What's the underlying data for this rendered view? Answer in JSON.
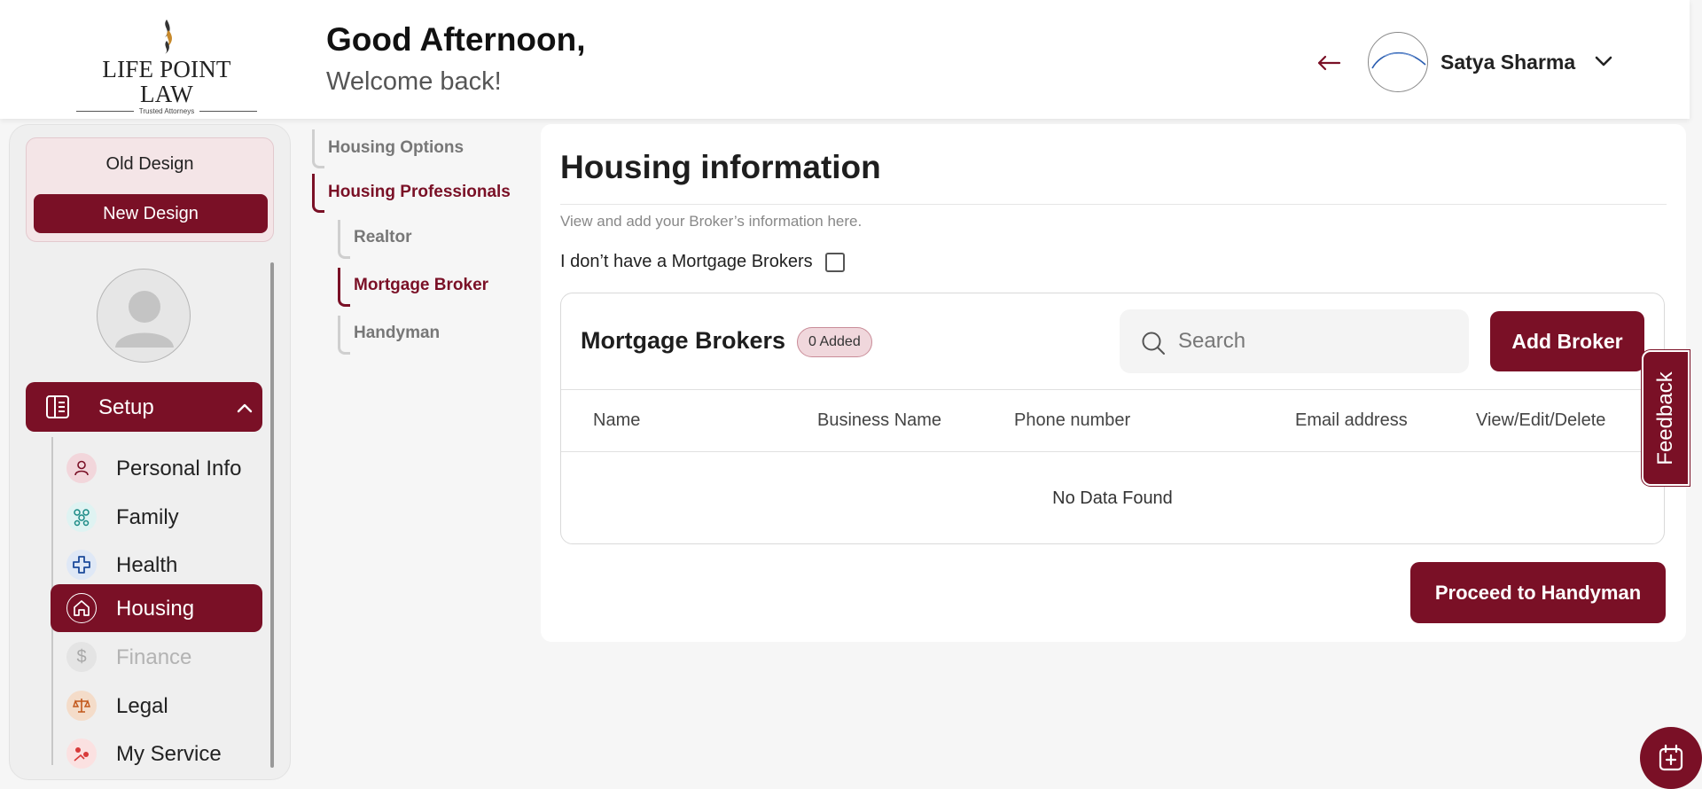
{
  "header": {
    "logo_text": "LIFE POINT LAW",
    "logo_tagline": "Trusted Attorneys",
    "greeting": "Good Afternoon,",
    "welcome": "Welcome back!",
    "user_name": "Satya Sharma"
  },
  "sidebar": {
    "old_design": "Old Design",
    "new_design": "New Design",
    "setup_label": "Setup",
    "items": [
      {
        "label": "Personal Info",
        "icon": "person-icon"
      },
      {
        "label": "Family",
        "icon": "family-icon"
      },
      {
        "label": "Health",
        "icon": "health-cross-icon"
      },
      {
        "label": "Housing",
        "icon": "house-icon",
        "active": true
      },
      {
        "label": "Finance",
        "icon": "dollar-icon",
        "disabled": true
      },
      {
        "label": "Legal",
        "icon": "scales-icon"
      },
      {
        "label": "My Service",
        "icon": "service-icon"
      }
    ]
  },
  "subnav": {
    "housing_options": "Housing Options",
    "housing_professionals": "Housing Professionals",
    "realtor": "Realtor",
    "mortgage_broker": "Mortgage Broker",
    "handyman": "Handyman"
  },
  "main": {
    "title": "Housing information",
    "description": "View and add your Broker’s information here.",
    "checkbox_label": "I don’t have a Mortgage Brokers",
    "checkbox_checked": false,
    "table": {
      "title": "Mortgage Brokers",
      "count_badge": "0 Added",
      "search_placeholder": "Search",
      "add_button": "Add Broker",
      "columns": [
        "Name",
        "Business Name",
        "Phone number",
        "Email address",
        "View/Edit/Delete"
      ],
      "rows": [],
      "empty_text": "No Data Found"
    },
    "proceed_button": "Proceed to Handyman"
  },
  "feedback_label": "Feedback",
  "colors": {
    "brand": "#7a1026",
    "badge_bg": "#f0d7dc",
    "sidebar_bg": "#efefef"
  }
}
